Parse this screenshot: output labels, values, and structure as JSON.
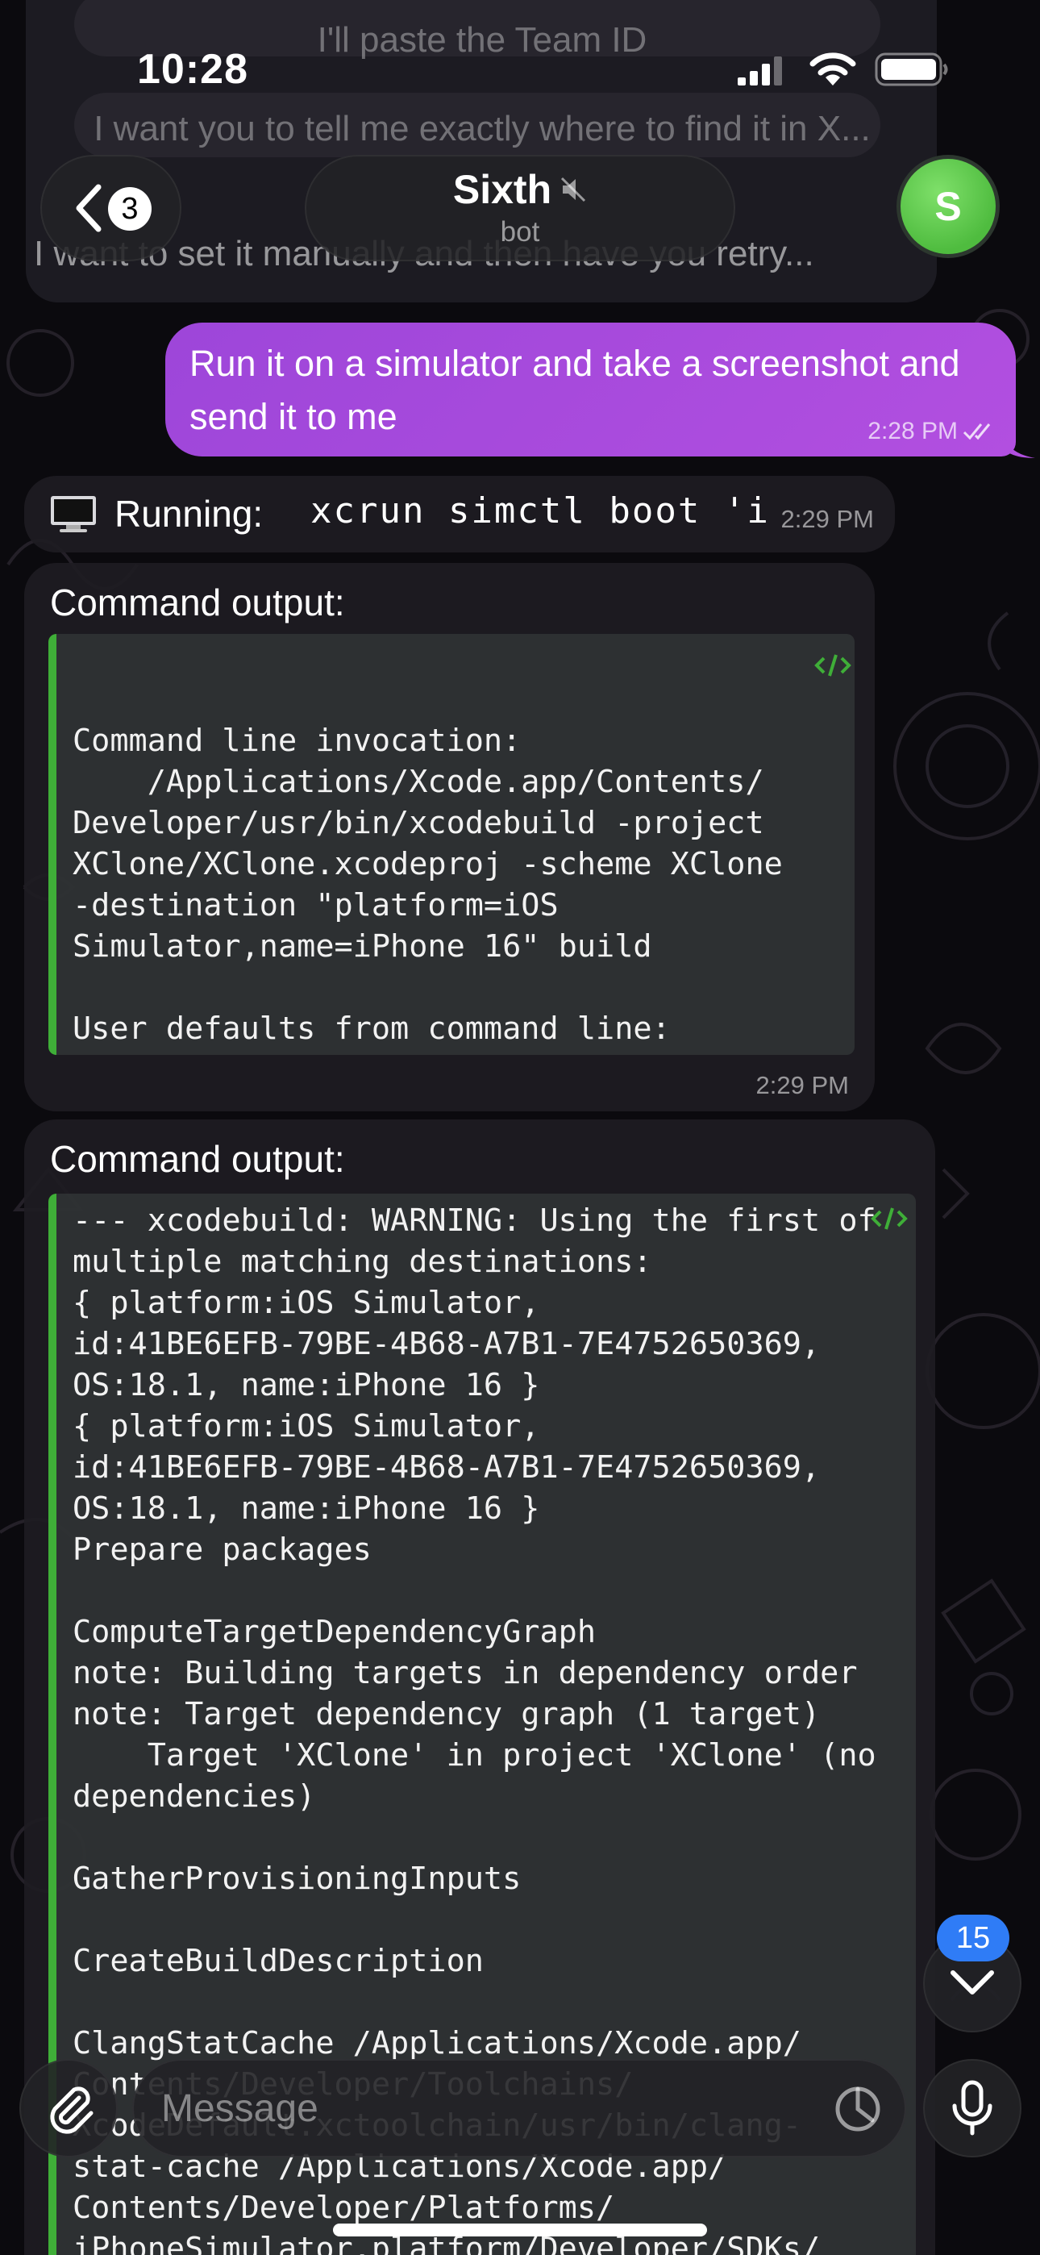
{
  "status_bar": {
    "time": "10:28"
  },
  "header": {
    "back_count": "3",
    "chat_title": "Sixth",
    "chat_subtitle": "bot",
    "avatar_letter": "S",
    "avatar_color": "#4fbc3f"
  },
  "previous_message": {
    "lines": [
      "I'll paste the Team ID",
      "I want you to tell me exactly where to find it in X...",
      "I want to set it manually and then have you retry..."
    ]
  },
  "messages": [
    {
      "direction": "outgoing",
      "text": "Run it on a simulator and take a screenshot and send it to me",
      "time": "2:28 PM",
      "status": "read"
    },
    {
      "direction": "incoming",
      "label": "Running:",
      "command": "xcrun simctl boot 'i",
      "time": "2:29 PM"
    },
    {
      "direction": "incoming",
      "title": "Command output:",
      "code": "\nCommand line invocation:\n    /Applications/Xcode.app/Contents/\nDeveloper/usr/bin/xcodebuild -project\nXClone/XClone.xcodeproj -scheme XClone\n-destination \"platform=iOS\nSimulator,name=iPhone 16\" build\n\nUser defaults from command line:\n    IDEPackageSupportUseBuiltinSCM = YES",
      "time": "2:29 PM"
    },
    {
      "direction": "incoming",
      "title": "Command output:",
      "code": "--- xcodebuild: WARNING: Using the first of\nmultiple matching destinations:\n{ platform:iOS Simulator,\nid:41BE6EFB-79BE-4B68-A7B1-7E4752650369,\nOS:18.1, name:iPhone 16 }\n{ platform:iOS Simulator,\nid:41BE6EFB-79BE-4B68-A7B1-7E4752650369,\nOS:18.1, name:iPhone 16 }\nPrepare packages\n\nComputeTargetDependencyGraph\nnote: Building targets in dependency order\nnote: Target dependency graph (1 target)\n    Target 'XClone' in project 'XClone' (no\ndependencies)\n\nGatherProvisioningInputs\n\nCreateBuildDescription\n\nClangStatCache /Applications/Xcode.app/\nContents/Developer/Toolchains/\nXcodeDefault.xctoolchain/usr/bin/clang-\nstat-cache /Applications/Xcode.app/\nContents/Developer/Platforms/\niPhoneSimulator.platform/Developer/SDKs/"
    }
  ],
  "scroll": {
    "unread_count": "15"
  },
  "composer": {
    "placeholder": "Message"
  },
  "colors": {
    "outgoing_bubble": "#a84be0",
    "code_accent": "#3fae38",
    "badge": "#2f7cf6"
  },
  "icons": [
    "monitor-icon",
    "code-icon",
    "mute-icon",
    "paperclip-icon",
    "sticker-icon",
    "microphone-icon",
    "chevron-down-icon",
    "chevron-left-icon",
    "signal-icon",
    "wifi-icon",
    "battery-icon",
    "read-checkmarks-icon"
  ]
}
